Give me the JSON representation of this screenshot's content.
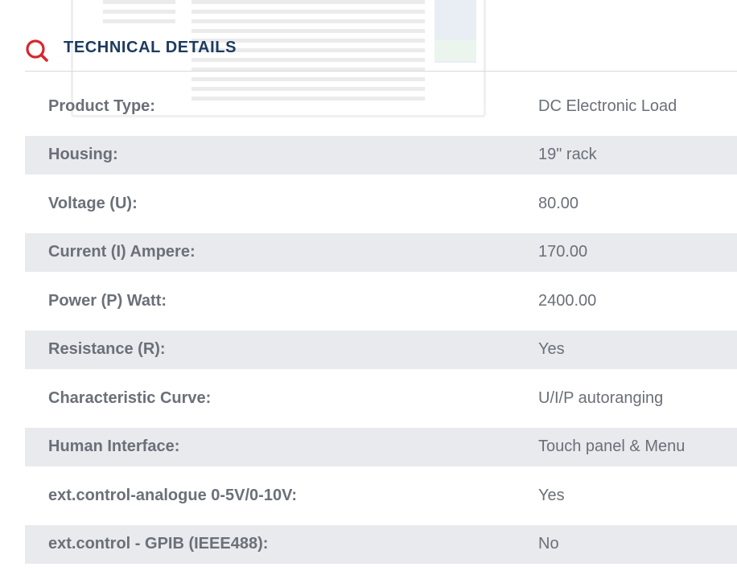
{
  "section": {
    "title": "TECHNICAL DETAILS",
    "icon": "search-icon",
    "accent_color": "#d8262c",
    "title_color": "#1c3b60"
  },
  "specs": [
    {
      "label": "Product Type:",
      "value": "DC Electronic Load"
    },
    {
      "label": "Housing:",
      "value": "19\" rack"
    },
    {
      "label": "Voltage (U):",
      "value": "80.00"
    },
    {
      "label": "Current (I) Ampere:",
      "value": "170.00"
    },
    {
      "label": "Power (P) Watt:",
      "value": "2400.00"
    },
    {
      "label": "Resistance (R):",
      "value": "Yes"
    },
    {
      "label": "Characteristic Curve:",
      "value": "U/I/P autoranging"
    },
    {
      "label": "Human Interface:",
      "value": "Touch panel & Menu"
    },
    {
      "label": "ext.control-analogue 0-5V/0-10V:",
      "value": "Yes"
    },
    {
      "label": "ext.control - GPIB (IEEE488):",
      "value": "No"
    }
  ],
  "colors": {
    "row_shade": "#e8eaee",
    "text": "#6b6f78",
    "divider": "#d6d9de"
  }
}
